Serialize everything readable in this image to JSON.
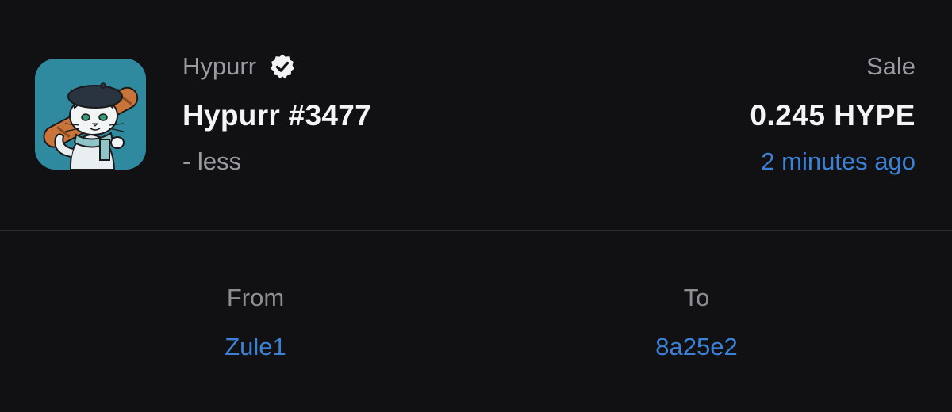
{
  "header": {
    "collection_name": "Hypurr",
    "verified_icon": "verified-badge-icon",
    "item_title": "Hypurr #3477",
    "toggle_label": "- less"
  },
  "sale": {
    "event_type": "Sale",
    "price": "0.245 HYPE",
    "time_ago": "2 minutes ago"
  },
  "transfer": {
    "from_label": "From",
    "from_value": "Zule1",
    "to_label": "To",
    "to_value": "8a25e2"
  },
  "colors": {
    "background": "#111114",
    "link": "#3b82d6",
    "muted_text": "#9a9a9f",
    "primary_text": "#f4f4f6",
    "thumbnail_bg": "#2f8aa0"
  }
}
